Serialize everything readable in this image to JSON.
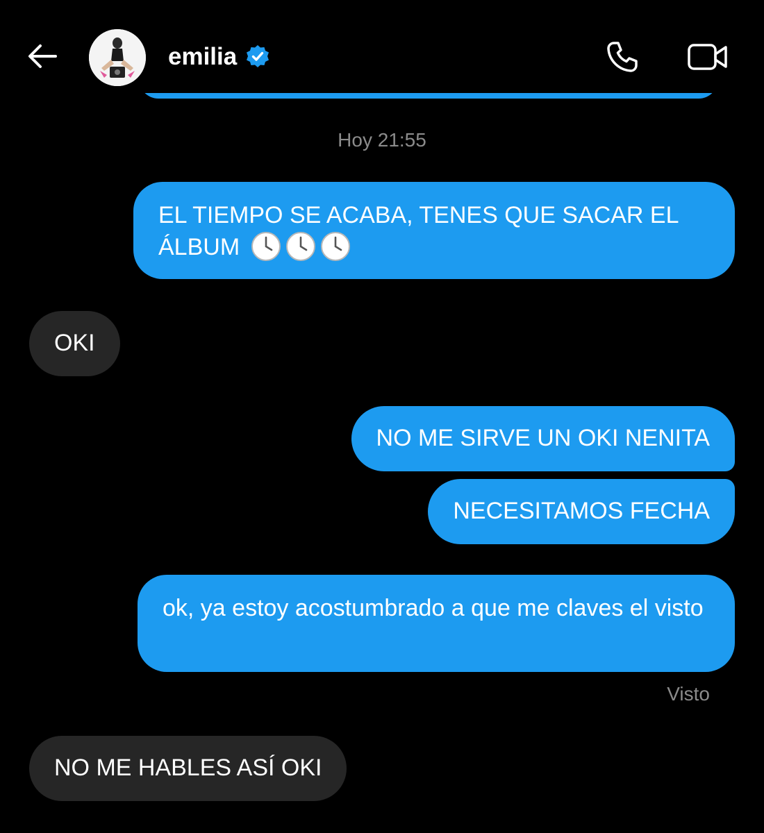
{
  "header": {
    "contact_name": "emilia",
    "back_icon": "arrow-left-icon",
    "verified_icon": "verified-badge-icon",
    "call_icon": "phone-icon",
    "video_icon": "video-camera-icon"
  },
  "thread": {
    "timestamp": "Hoy 21:55",
    "messages": [
      {
        "direction": "outgoing",
        "text": "EL TIEMPO SE ACABA, TENES QUE SACAR EL ÁLBUM",
        "trailing_icons": [
          "clock-icon",
          "clock-icon",
          "clock-icon"
        ]
      },
      {
        "direction": "incoming",
        "text": "OKI"
      },
      {
        "direction": "outgoing",
        "text": "NO ME SIRVE UN OKI NENITA"
      },
      {
        "direction": "outgoing",
        "text": "NECESITAMOS FECHA"
      },
      {
        "direction": "outgoing",
        "text": "ok, ya estoy acostumbrado a que me claves el visto"
      },
      {
        "direction": "incoming",
        "text": "NO ME HABLES ASÍ OKI"
      }
    ],
    "seen_status": "Visto"
  },
  "colors": {
    "background": "#000000",
    "outgoing_bubble": "#1d9bf0",
    "incoming_bubble": "#262626",
    "muted_text": "#8b8b8b",
    "verified_badge": "#1d9bf0"
  }
}
